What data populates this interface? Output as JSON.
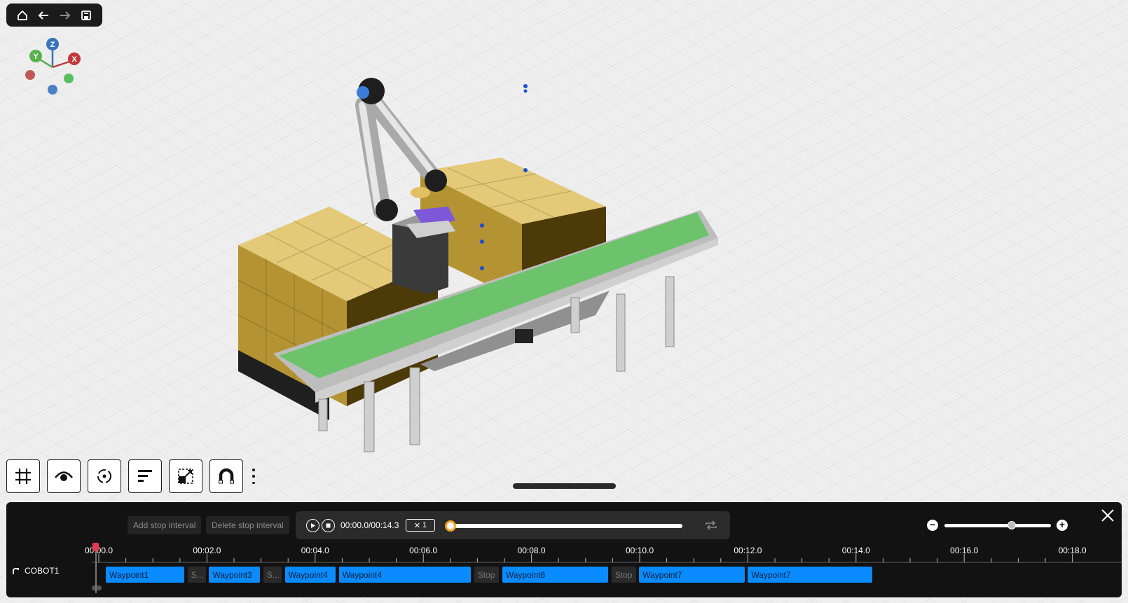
{
  "nav": {
    "items": [
      {
        "name": "home-icon",
        "enabled": true
      },
      {
        "name": "back-arrow-icon",
        "enabled": true
      },
      {
        "name": "forward-arrow-icon",
        "enabled": false
      },
      {
        "name": "save-icon",
        "enabled": true
      }
    ]
  },
  "gizmo": {
    "z": "Z",
    "y": "Y",
    "x": "X"
  },
  "toolbar": {
    "tools": [
      "grid-icon",
      "eye-icon",
      "orbit-icon",
      "align-icon",
      "scale-icon",
      "magnet-icon",
      "more-vertical-icon"
    ]
  },
  "timeline": {
    "add_stop_label": "Add stop interval",
    "delete_stop_label": "Delete stop interval",
    "time_display": "00:00.0/00:14.3",
    "speed_prefix": "✕",
    "speed_value": "1",
    "progress": 0.0,
    "zoom_minus": "−",
    "zoom_plus": "+",
    "zoom_level": 0.63,
    "ruler_ticks": [
      "00:00.0",
      "00:02.0",
      "00:04.0",
      "00:06.0",
      "00:08.0",
      "00:10.0",
      "00:12.0",
      "00:14.0",
      "00:16.0",
      "00:18.0"
    ],
    "track_name": "COBOT1",
    "segments": [
      {
        "label": "Waypoint1",
        "kind": "wp",
        "start": 0.13,
        "end": 1.58
      },
      {
        "label": "S...",
        "kind": "stop",
        "start": 1.64,
        "end": 1.98
      },
      {
        "label": "Waypoint3",
        "kind": "wp",
        "start": 2.04,
        "end": 2.98
      },
      {
        "label": "S...",
        "kind": "stop",
        "start": 3.04,
        "end": 3.38
      },
      {
        "label": "Waypoint4",
        "kind": "wp",
        "start": 3.44,
        "end": 4.38
      },
      {
        "label": "Waypoint4",
        "kind": "wp",
        "start": 4.44,
        "end": 6.88
      },
      {
        "label": "Stop",
        "kind": "stop",
        "start": 6.94,
        "end": 7.4
      },
      {
        "label": "Waypoint6",
        "kind": "wp",
        "start": 7.46,
        "end": 9.42
      },
      {
        "label": "Stop",
        "kind": "stop",
        "start": 9.48,
        "end": 9.93
      },
      {
        "label": "Waypoint7",
        "kind": "wp",
        "start": 9.99,
        "end": 11.94
      },
      {
        "label": "Waypoint7",
        "kind": "wp",
        "start": 12.0,
        "end": 14.3
      }
    ]
  },
  "colors": {
    "accent_blue": "#0a8bff",
    "playhead_red": "#e53950",
    "progress_knob": "#f5a623",
    "belt_green": "#6cc36b",
    "box_gold": "#d3b865"
  }
}
